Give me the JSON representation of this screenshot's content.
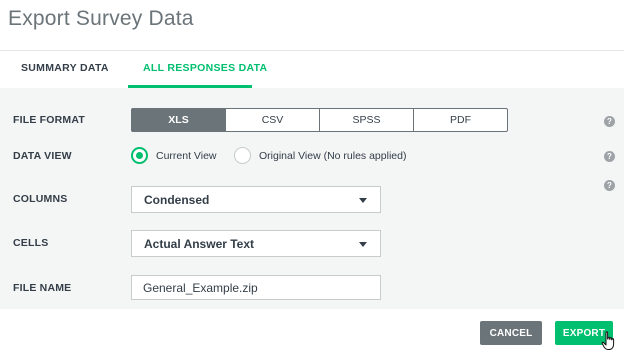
{
  "dialog": {
    "title": "Export Survey Data"
  },
  "tabs": [
    {
      "label": "SUMMARY DATA",
      "active": false
    },
    {
      "label": "ALL RESPONSES DATA",
      "active": true
    }
  ],
  "file_format": {
    "label": "FILE FORMAT",
    "options": [
      "XLS",
      "CSV",
      "SPSS",
      "PDF"
    ],
    "selected": "XLS"
  },
  "data_view": {
    "label": "DATA VIEW",
    "options": [
      {
        "label": "Current View",
        "checked": true
      },
      {
        "label": "Original View (No rules applied)",
        "checked": false
      }
    ]
  },
  "columns": {
    "label": "COLUMNS",
    "value": "Condensed"
  },
  "cells": {
    "label": "CELLS",
    "value": "Actual Answer Text"
  },
  "file_name": {
    "label": "FILE NAME",
    "value": "General_Example.zip"
  },
  "help_glyph": "?",
  "buttons": {
    "cancel": "CANCEL",
    "export": "EXPORT"
  },
  "icons": {
    "help": "help-icon",
    "cursor": "hand-pointer-icon",
    "dropdown": "chevron-down-icon"
  },
  "colors": {
    "accent": "#00bf6f",
    "segment_active": "#6b7479",
    "cancel_button": "#6b7479",
    "panel_bg": "#f4f5f5",
    "text": "#333e48"
  }
}
